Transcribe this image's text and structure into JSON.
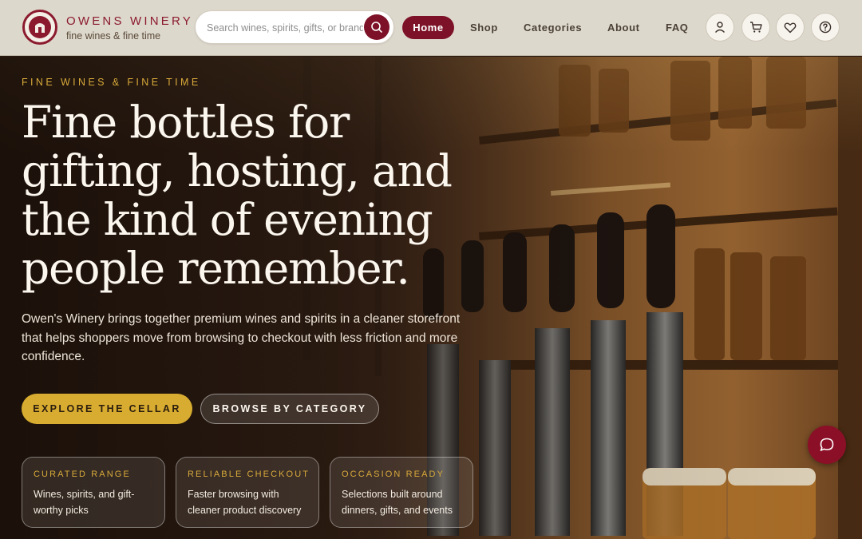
{
  "brand": {
    "name": "OWENS WINERY",
    "tagline": "fine wines & fine time",
    "logo_icon": "wine-cellar-logo",
    "accent_color": "#7d1127"
  },
  "search": {
    "placeholder": "Search wines, spirits, gifts, or brands",
    "value": "",
    "icon": "search-icon"
  },
  "nav": {
    "home": "Home",
    "shop": "Shop",
    "categories": "Categories",
    "about": "About",
    "faq": "FAQ",
    "active": "Home"
  },
  "header_icons": [
    "user-icon",
    "cart-icon",
    "heart-icon",
    "help-icon"
  ],
  "hero": {
    "eyebrow": "FINE WINES & FINE TIME",
    "headline": "Fine bottles for gifting, hosting, and the kind of evening people remember.",
    "subcopy": "Owen's Winery brings together premium wines and spirits in a cleaner storefront that helps shoppers move from browsing to checkout with less friction and more confidence.",
    "primary_cta": "EXPLORE THE CELLAR",
    "secondary_cta": "BROWSE BY CATEGORY",
    "primary_color": "#d8ac30"
  },
  "features": [
    {
      "title": "CURATED RANGE",
      "text": "Wines, spirits, and gift-worthy picks"
    },
    {
      "title": "RELIABLE CHECKOUT",
      "text": "Faster browsing with cleaner product discovery"
    },
    {
      "title": "OCCASION READY",
      "text": "Selections built around dinners, gifts, and events"
    }
  ],
  "chat": {
    "icon": "chat-bubble-icon"
  }
}
